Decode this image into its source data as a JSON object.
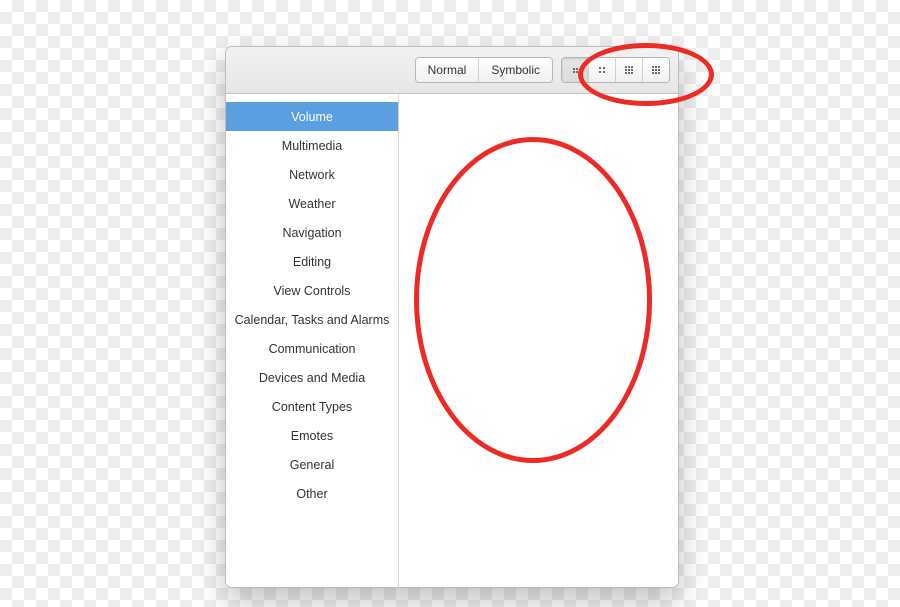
{
  "toolbar": {
    "seg_type": {
      "options": [
        {
          "label": "Normal",
          "active": false
        },
        {
          "label": "Symbolic",
          "active": false
        }
      ]
    },
    "seg_size": {
      "options": [
        {
          "icon": "grid-2",
          "active": true
        },
        {
          "icon": "grid-2b",
          "active": false
        },
        {
          "icon": "grid-3",
          "active": false
        },
        {
          "icon": "grid-4",
          "active": false
        }
      ]
    }
  },
  "sidebar": {
    "items": [
      {
        "label": "Volume",
        "selected": true
      },
      {
        "label": "Multimedia",
        "selected": false
      },
      {
        "label": "Network",
        "selected": false
      },
      {
        "label": "Weather",
        "selected": false
      },
      {
        "label": "Navigation",
        "selected": false
      },
      {
        "label": "Editing",
        "selected": false
      },
      {
        "label": "View Controls",
        "selected": false
      },
      {
        "label": "Calendar, Tasks and Alarms",
        "selected": false
      },
      {
        "label": "Communication",
        "selected": false
      },
      {
        "label": "Devices and Media",
        "selected": false
      },
      {
        "label": "Content Types",
        "selected": false
      },
      {
        "label": "Emotes",
        "selected": false
      },
      {
        "label": "General",
        "selected": false
      },
      {
        "label": "Other",
        "selected": false
      }
    ]
  },
  "annotations": {
    "toolbar_circle": "red-oval",
    "content_circle": "red-oval"
  }
}
